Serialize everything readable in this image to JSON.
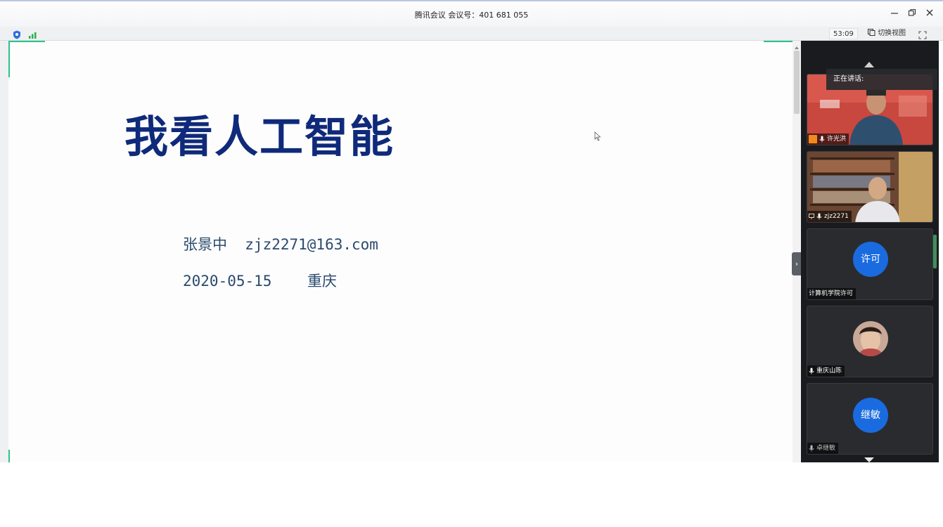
{
  "window": {
    "title": "腾讯会议 会议号：401 681 055",
    "minimize_icon": "minimize-icon",
    "restore_icon": "restore-icon",
    "close_icon": "close-icon"
  },
  "toolbar": {
    "timer": "53:09",
    "switch_view_label": "切换视图",
    "icons": [
      "shield-icon",
      "signal-icon",
      "switch-view-icon",
      "fullscreen-icon"
    ]
  },
  "slide": {
    "title": "我看人工智能",
    "author_line": "张景中  zjz2271@163.com",
    "date_line": "2020-05-15    重庆"
  },
  "panel": {
    "speaking_label": "正在讲话:",
    "participants": [
      {
        "name": "许光洪",
        "type": "video"
      },
      {
        "name": "zjz2271",
        "type": "video"
      },
      {
        "name": "计算机学院许可",
        "type": "avatar",
        "avatar_text": "许可"
      },
      {
        "name": "重庆山陈",
        "type": "photo"
      },
      {
        "name": "卓继敏",
        "type": "avatar",
        "avatar_text": "继敏"
      }
    ]
  },
  "colors": {
    "accent_green": "#2bc48a",
    "avatar_blue": "#1a6be0",
    "slide_title": "#0f2a7a",
    "slide_text": "#2a4a6e",
    "panel_bg": "#1a1b1e"
  }
}
